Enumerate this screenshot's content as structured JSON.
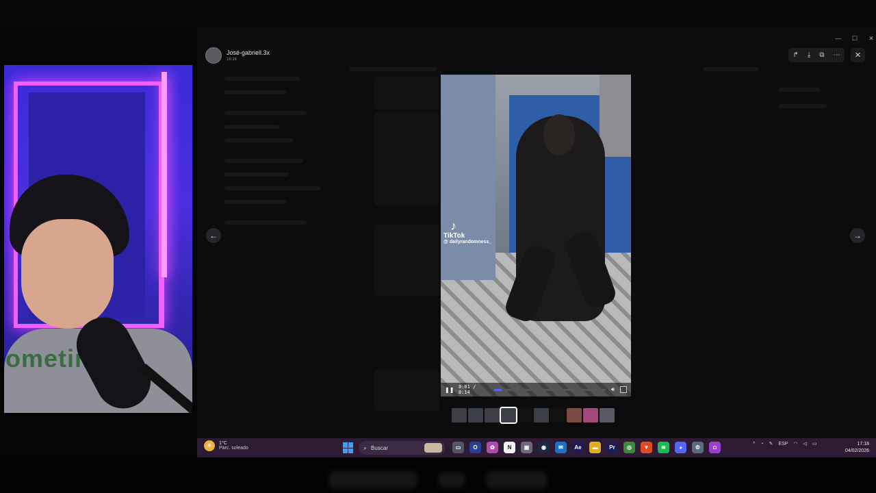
{
  "viewer": {
    "username": "José-gabriell.3x",
    "time": "16:16",
    "toolbar_icons": [
      "forward-icon",
      "download-icon",
      "open-external-icon",
      "more-icon"
    ]
  },
  "video": {
    "platform": "TikTok",
    "handle": "@ dailyrandomness_",
    "time_display": "0:01 / 0:14",
    "progress": 0.07
  },
  "taskbar": {
    "weather_temp": "1°C",
    "weather_desc": "Parc. soleado",
    "search_placeholder": "Buscar",
    "language": "ESP",
    "time": "17:18",
    "date": "04/02/2026",
    "apps": [
      {
        "name": "task-view",
        "color": "#555566",
        "glyph": "▭"
      },
      {
        "name": "browser-o",
        "color": "#2a3f9a",
        "glyph": "O"
      },
      {
        "name": "photos",
        "color": "#b04ab0",
        "glyph": "✿"
      },
      {
        "name": "notion",
        "color": "#f2f2f2",
        "glyph": "N"
      },
      {
        "name": "capture",
        "color": "#6a6a78",
        "glyph": "▣"
      },
      {
        "name": "steam",
        "color": "#1b2a44",
        "glyph": "◉"
      },
      {
        "name": "mail",
        "color": "#1a73c8",
        "glyph": "✉"
      },
      {
        "name": "after-effects",
        "color": "#1d1a55",
        "glyph": "Ae"
      },
      {
        "name": "explorer",
        "color": "#e0b020",
        "glyph": "▬"
      },
      {
        "name": "premiere",
        "color": "#1d1a55",
        "glyph": "Pr"
      },
      {
        "name": "chrome",
        "color": "#3a8a3a",
        "glyph": "◎"
      },
      {
        "name": "brave",
        "color": "#e04a22",
        "glyph": "▼"
      },
      {
        "name": "spotify",
        "color": "#1db954",
        "glyph": "≋"
      },
      {
        "name": "discord",
        "color": "#5865f2",
        "glyph": "◕"
      },
      {
        "name": "settings",
        "color": "#5a6b7c",
        "glyph": "⚙"
      },
      {
        "name": "app-purple",
        "color": "#9b3fd4",
        "glyph": "◘"
      }
    ]
  },
  "colors": {
    "accent": "#5865f2",
    "taskbar": "#2c1b33"
  }
}
